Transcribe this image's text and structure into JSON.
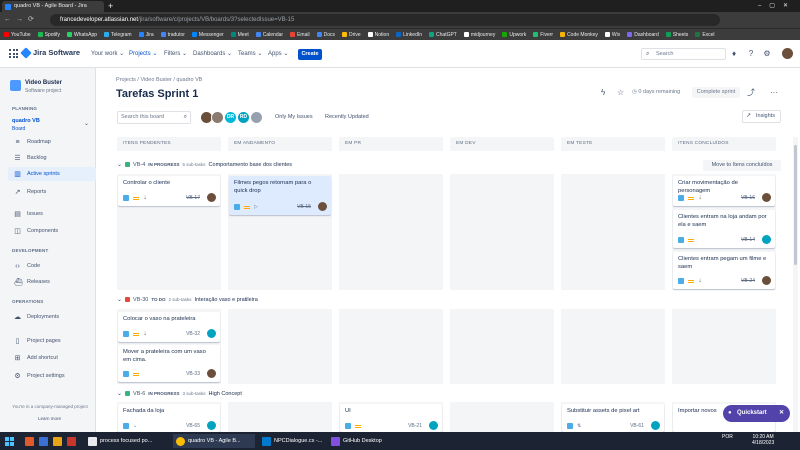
{
  "browser": {
    "tab_title": "quadro VB - Agile Board - Jira",
    "url_host": "francedeveloper.atlassian.net",
    "url_path": "/jira/software/c/projects/VB/boards/3?selectedIssue=VB-15",
    "bookmarks": [
      {
        "label": "YouTube",
        "color": "#ff0000"
      },
      {
        "label": "Spotify",
        "color": "#1db954"
      },
      {
        "label": "WhatsApp",
        "color": "#25d366"
      },
      {
        "label": "Telegram",
        "color": "#2aabee"
      },
      {
        "label": "Jira",
        "color": "#2684ff"
      },
      {
        "label": "tradutor",
        "color": "#4285f4"
      },
      {
        "label": "Messenger",
        "color": "#0084ff"
      },
      {
        "label": "Meet",
        "color": "#00897b"
      },
      {
        "label": "Calendar",
        "color": "#4285f4"
      },
      {
        "label": "Email",
        "color": "#ea4335"
      },
      {
        "label": "Docs",
        "color": "#4285f4"
      },
      {
        "label": "Drive",
        "color": "#fbbc04"
      },
      {
        "label": "Notion",
        "color": "#ffffff"
      },
      {
        "label": "LinkedIn",
        "color": "#0a66c2"
      },
      {
        "label": "ChatGPT",
        "color": "#10a37f"
      },
      {
        "label": "midjourney",
        "color": "#ffffff"
      },
      {
        "label": "Upwork",
        "color": "#14a800"
      },
      {
        "label": "Fiverr",
        "color": "#1dbf73"
      },
      {
        "label": "Code Monkey",
        "color": "#f4b400"
      },
      {
        "label": "Wix",
        "color": "#ffffff"
      },
      {
        "label": "Dashboard",
        "color": "#7b68ee"
      },
      {
        "label": "Sheets",
        "color": "#0f9d58"
      },
      {
        "label": "Excel",
        "color": "#217346"
      }
    ]
  },
  "topnav": {
    "product": "Jira Software",
    "items": [
      "Your work",
      "Projects",
      "Filters",
      "Dashboards",
      "Teams",
      "Apps"
    ],
    "create": "Create",
    "search_placeholder": "Search"
  },
  "sidebar": {
    "project_name": "Video Buster",
    "project_type": "Software project",
    "planning_label": "PLANNING",
    "board_name": "quadro VB",
    "board_sub": "Board",
    "planning_items": [
      "Roadmap",
      "Backlog",
      "Active sprints",
      "Reports"
    ],
    "other_items": [
      "Issues",
      "Components"
    ],
    "development_label": "DEVELOPMENT",
    "dev_items": [
      "Code",
      "Releases"
    ],
    "operations_label": "OPERATIONS",
    "ops_items": [
      "Deployments"
    ],
    "bottom_items": [
      "Project pages",
      "Add shortcut",
      "Project settings"
    ],
    "footer": "You're in a company-managed project",
    "learn_more": "Learn more"
  },
  "main": {
    "breadcrumb": "Projects  /  Video Buster  /  quadro VB",
    "title": "Tarefas Sprint 1",
    "days_remaining": "0 days remaining",
    "complete_sprint": "Complete sprint",
    "board_search_placeholder": "Search this board",
    "avatars": [
      {
        "label": "",
        "color": "#6b4f3a"
      },
      {
        "label": "",
        "color": "#8a7a70"
      },
      {
        "label": "DR",
        "color": "#00b8d9"
      },
      {
        "label": "RD",
        "color": "#00a3bf"
      },
      {
        "label": "",
        "color": "#97a0af"
      }
    ],
    "only_my_issues": "Only My Issues",
    "recently_updated": "Recently Updated",
    "insights": "Insights",
    "columns": [
      "ITENS PENDENTES",
      "EM ANDAMENTO",
      "EM PR",
      "EM DEV",
      "EM TESTE",
      "ITENS CONCLUÍDOS"
    ],
    "move_button": "Move to Itens concluídos",
    "swimlanes": [
      {
        "key": "VB-4",
        "status": "IN PROGRESS",
        "subtasks": "5 sub-tasks",
        "summary": "Comportamento base dos clientes",
        "icon_color": "#36b37e"
      },
      {
        "key": "VB-30",
        "status": "TO DO",
        "subtasks": "2 sub-tasks",
        "summary": "Interação vaso e pratileira",
        "icon_color": "#e5493a"
      },
      {
        "key": "VB-6",
        "status": "IN PROGRESS",
        "subtasks": "3 sub-tasks",
        "summary": "High Concept",
        "icon_color": "#36b37e"
      }
    ],
    "cards": {
      "c1": {
        "title": "Controlar o cliente",
        "key": "VB-17"
      },
      "c2": {
        "title": "Filmes pegos retornam para o quick drop",
        "key": "VB-15"
      },
      "c3": {
        "title": "Criar movimentação de personagem",
        "key": "VB-16"
      },
      "c4": {
        "title": "Clientes entram na loja andam por ela e saem",
        "key": "VB-14"
      },
      "c5": {
        "title": "Clientes entram pegam um filme e saem",
        "key": "VB-24"
      },
      "c6": {
        "title": "Colocar o vaso na prateleira",
        "key": "VB-32"
      },
      "c7": {
        "title": "Mover a prateleira com um vaso em cima.",
        "key": "VB-33"
      },
      "c8": {
        "title": "Fachada da loja",
        "key": "VB-65"
      },
      "c9": {
        "title": "UI",
        "key": "VB-21"
      },
      "c10": {
        "title": "Substituir assets de pixel art",
        "key": "VB-61"
      },
      "c11": {
        "title": "Importar novos",
        "key": ""
      }
    },
    "quickstart": "Quickstart"
  },
  "taskbar": {
    "apps": [
      {
        "label": "process focused po...",
        "color": "#e8eaed"
      },
      {
        "label": "quadro VB - Agile B...",
        "color": "#fbbc04"
      },
      {
        "label": "NPCDialogue.cs -...",
        "color": "#007acc"
      },
      {
        "label": "GitHub Desktop",
        "color": "#8250df"
      }
    ],
    "lang": "POR",
    "time": "10:20 AM",
    "date": "4/18/2023"
  }
}
